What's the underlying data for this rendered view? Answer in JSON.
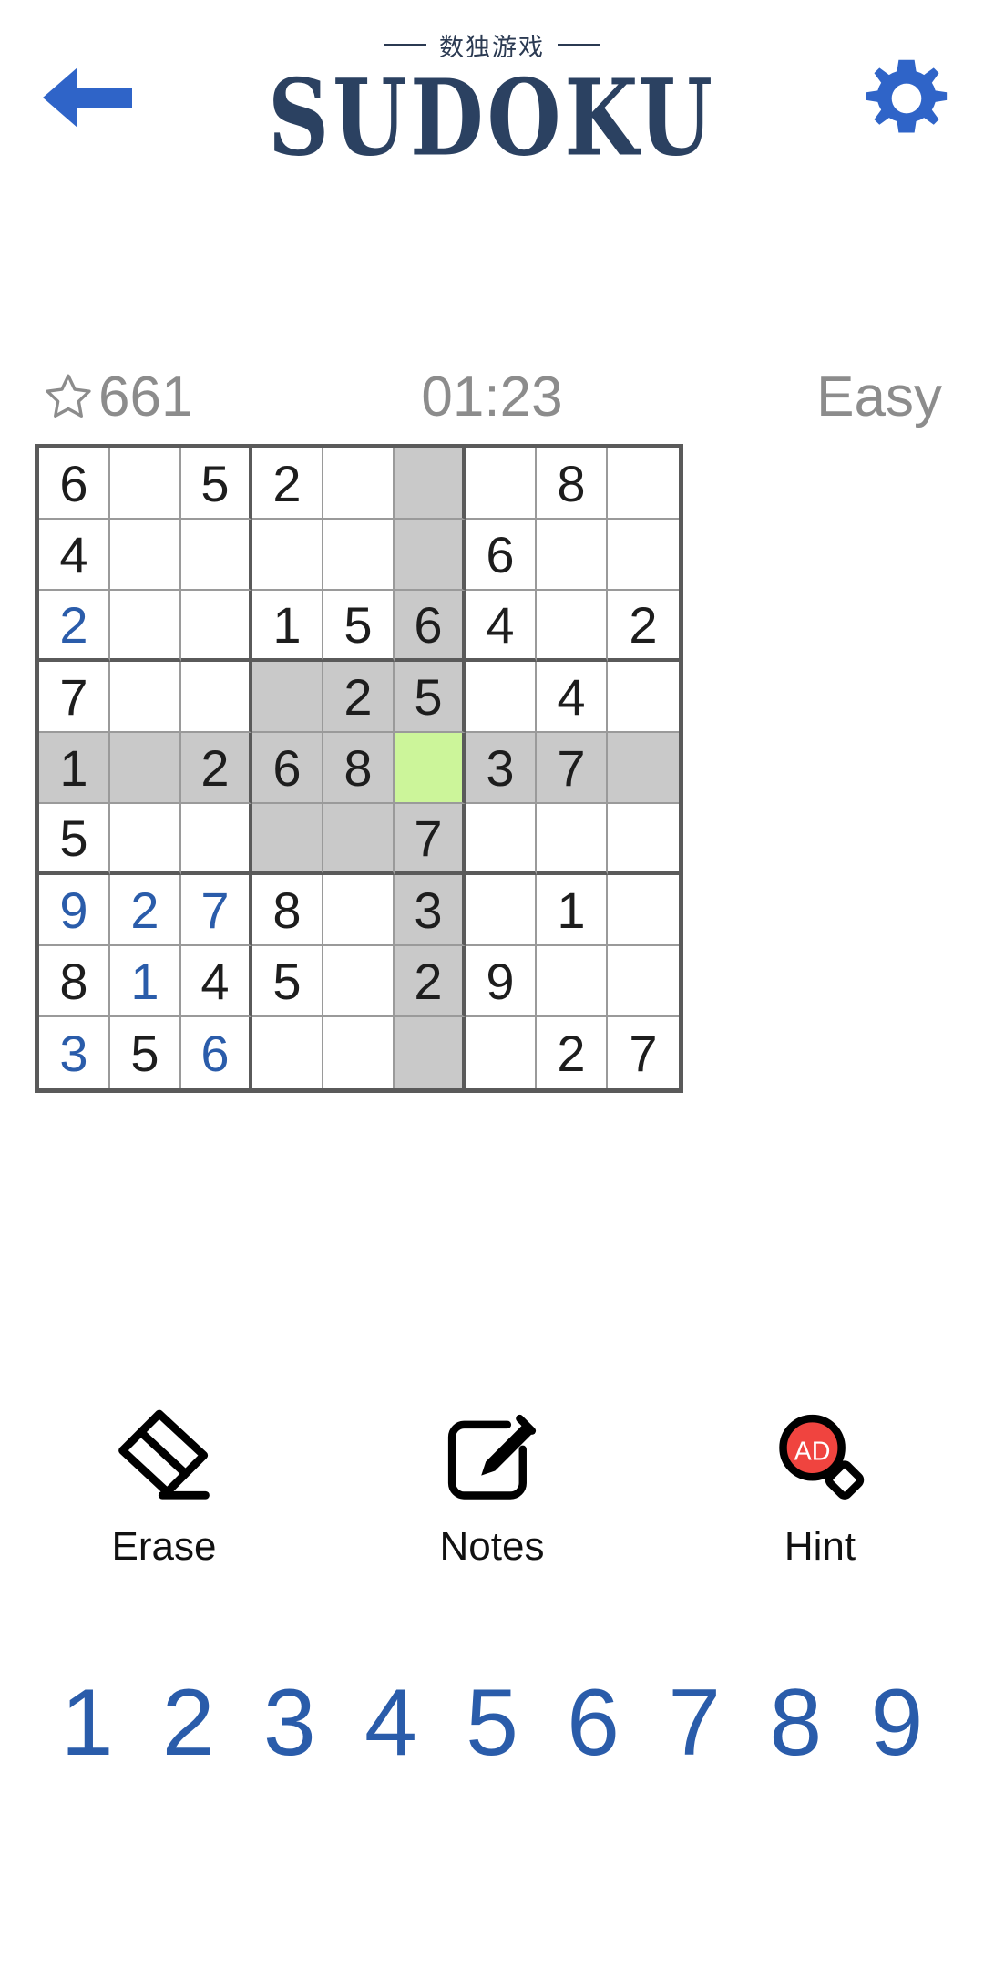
{
  "header": {
    "back_icon": "arrow-left-icon",
    "settings_icon": "gear-icon",
    "title_cn": "数独游戏",
    "title_main": "SUDOKU",
    "accent_color": "#2b4161",
    "icon_color": "#2f64c8"
  },
  "status": {
    "star_icon": "star-outline-icon",
    "score": "661",
    "timer": "01:23",
    "difficulty": "Easy",
    "text_color": "#8c8c8c"
  },
  "board": {
    "selected": {
      "row": 5,
      "col": 6
    },
    "colors": {
      "given": "#1d1d1d",
      "user": "#2a5caa",
      "highlight": "#c9c9c9",
      "selected": "#ccf59a",
      "grid_line": "#5a5a5a"
    },
    "rows": [
      [
        {
          "v": "6",
          "t": "given"
        },
        {
          "v": "",
          "t": "empty"
        },
        {
          "v": "5",
          "t": "given"
        },
        {
          "v": "2",
          "t": "given"
        },
        {
          "v": "",
          "t": "empty"
        },
        {
          "v": "",
          "t": "empty",
          "hl": true
        },
        {
          "v": "",
          "t": "empty"
        },
        {
          "v": "8",
          "t": "given"
        },
        {
          "v": "",
          "t": "empty"
        }
      ],
      [
        {
          "v": "4",
          "t": "given"
        },
        {
          "v": "",
          "t": "empty"
        },
        {
          "v": "",
          "t": "empty"
        },
        {
          "v": "",
          "t": "empty"
        },
        {
          "v": "",
          "t": "empty"
        },
        {
          "v": "",
          "t": "empty",
          "hl": true
        },
        {
          "v": "6",
          "t": "given"
        },
        {
          "v": "",
          "t": "empty"
        },
        {
          "v": "",
          "t": "empty"
        }
      ],
      [
        {
          "v": "2",
          "t": "user"
        },
        {
          "v": "",
          "t": "empty"
        },
        {
          "v": "",
          "t": "empty"
        },
        {
          "v": "1",
          "t": "given"
        },
        {
          "v": "5",
          "t": "given"
        },
        {
          "v": "6",
          "t": "given",
          "hl": true
        },
        {
          "v": "4",
          "t": "given"
        },
        {
          "v": "",
          "t": "empty"
        },
        {
          "v": "2",
          "t": "given"
        }
      ],
      [
        {
          "v": "7",
          "t": "given"
        },
        {
          "v": "",
          "t": "empty"
        },
        {
          "v": "",
          "t": "empty"
        },
        {
          "v": "",
          "t": "empty",
          "hl": true
        },
        {
          "v": "2",
          "t": "given",
          "hl": true
        },
        {
          "v": "5",
          "t": "given",
          "hl": true
        },
        {
          "v": "",
          "t": "empty"
        },
        {
          "v": "4",
          "t": "given"
        },
        {
          "v": "",
          "t": "empty"
        }
      ],
      [
        {
          "v": "1",
          "t": "given",
          "hl": true
        },
        {
          "v": "",
          "t": "empty",
          "hl": true
        },
        {
          "v": "2",
          "t": "given",
          "hl": true
        },
        {
          "v": "6",
          "t": "given",
          "hl": true
        },
        {
          "v": "8",
          "t": "given",
          "hl": true
        },
        {
          "v": "",
          "t": "empty",
          "sel": true
        },
        {
          "v": "3",
          "t": "given",
          "hl": true
        },
        {
          "v": "7",
          "t": "given",
          "hl": true
        },
        {
          "v": "",
          "t": "empty",
          "hl": true
        }
      ],
      [
        {
          "v": "5",
          "t": "given"
        },
        {
          "v": "",
          "t": "empty"
        },
        {
          "v": "",
          "t": "empty"
        },
        {
          "v": "",
          "t": "empty",
          "hl": true
        },
        {
          "v": "",
          "t": "empty",
          "hl": true
        },
        {
          "v": "7",
          "t": "given",
          "hl": true
        },
        {
          "v": "",
          "t": "empty"
        },
        {
          "v": "",
          "t": "empty"
        },
        {
          "v": "",
          "t": "empty"
        }
      ],
      [
        {
          "v": "9",
          "t": "user"
        },
        {
          "v": "2",
          "t": "user"
        },
        {
          "v": "7",
          "t": "user"
        },
        {
          "v": "8",
          "t": "given"
        },
        {
          "v": "",
          "t": "empty"
        },
        {
          "v": "3",
          "t": "given",
          "hl": true
        },
        {
          "v": "",
          "t": "empty"
        },
        {
          "v": "1",
          "t": "given"
        },
        {
          "v": "",
          "t": "empty"
        }
      ],
      [
        {
          "v": "8",
          "t": "given"
        },
        {
          "v": "1",
          "t": "user"
        },
        {
          "v": "4",
          "t": "given"
        },
        {
          "v": "5",
          "t": "given"
        },
        {
          "v": "",
          "t": "empty"
        },
        {
          "v": "2",
          "t": "given",
          "hl": true
        },
        {
          "v": "9",
          "t": "given"
        },
        {
          "v": "",
          "t": "empty"
        },
        {
          "v": "",
          "t": "empty"
        }
      ],
      [
        {
          "v": "3",
          "t": "user"
        },
        {
          "v": "5",
          "t": "given"
        },
        {
          "v": "6",
          "t": "user"
        },
        {
          "v": "",
          "t": "empty"
        },
        {
          "v": "",
          "t": "empty"
        },
        {
          "v": "",
          "t": "empty",
          "hl": true
        },
        {
          "v": "",
          "t": "empty"
        },
        {
          "v": "2",
          "t": "given"
        },
        {
          "v": "7",
          "t": "given"
        }
      ]
    ]
  },
  "actions": [
    {
      "key": "erase",
      "label": "Erase",
      "icon": "eraser-icon"
    },
    {
      "key": "notes",
      "label": "Notes",
      "icon": "note-pencil-icon"
    },
    {
      "key": "hint",
      "label": "Hint",
      "icon": "magnifier-ad-icon",
      "badge": "AD",
      "badge_color": "#f0443f"
    }
  ],
  "numpad": [
    "1",
    "2",
    "3",
    "4",
    "5",
    "6",
    "7",
    "8",
    "9"
  ]
}
